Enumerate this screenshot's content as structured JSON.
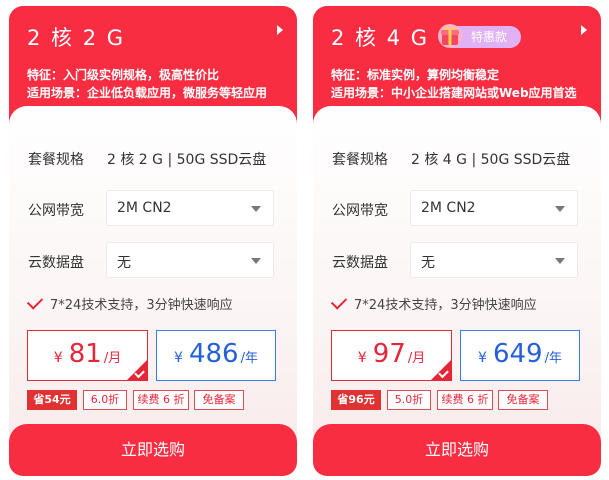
{
  "plans": [
    {
      "title": "2 核 2 G",
      "feature": "特征：入门级实例规格，极高性价比",
      "scenario": "适用场景：企业低负载应用，微服务等轻应用",
      "spec_label": "套餐规格",
      "spec_value": "2 核 2 G | 50G SSD云盘",
      "bandwidth_label": "公网带宽",
      "bandwidth_value": "2M CN2",
      "disk_label": "云数据盘",
      "disk_value": "无",
      "support": "7*24技术支持，3分钟快速响应",
      "month_currency": "¥",
      "month_price": "81",
      "month_unit": "/月",
      "year_currency": "¥",
      "year_price": "486",
      "year_unit": "/年",
      "save_tag": "省54元",
      "discount_tag": "6.0折",
      "renew_tag": "续费 6 折",
      "filing_tag": "免备案",
      "buy_label": "立即选购"
    },
    {
      "title": "2 核 4 G",
      "badge": "特惠款",
      "feature": "特征：标准实例，算例均衡稳定",
      "scenario": "适用场景：中小企业搭建网站或Web应用首选",
      "spec_label": "套餐规格",
      "spec_value": "2 核 4 G | 50G SSD云盘",
      "bandwidth_label": "公网带宽",
      "bandwidth_value": "2M CN2",
      "disk_label": "云数据盘",
      "disk_value": "无",
      "support": "7*24技术支持，3分钟快速响应",
      "month_currency": "¥",
      "month_price": "97",
      "month_unit": "/月",
      "year_currency": "¥",
      "year_price": "649",
      "year_unit": "/年",
      "save_tag": "省96元",
      "discount_tag": "5.0折",
      "renew_tag": "续费 6 折",
      "filing_tag": "免备案",
      "buy_label": "立即选购"
    }
  ],
  "colors": {
    "brand_red": "#f82d41",
    "price_blue": "#2560d8",
    "badge_purple": "#e0b2f4"
  },
  "icons": [
    "chevron-right-icon",
    "gift-icon",
    "check-icon",
    "caret-down-icon",
    "selected-check-icon"
  ]
}
